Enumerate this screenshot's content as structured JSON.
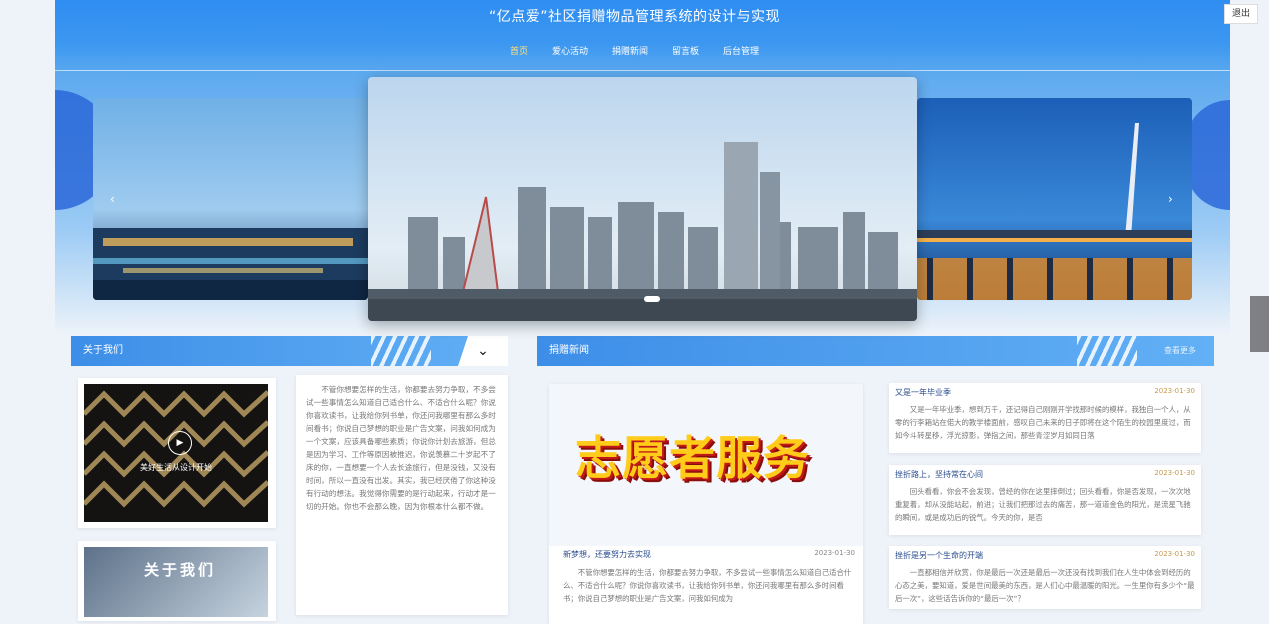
{
  "header": {
    "title": "“亿点爱”社区捐赠物品管理系统的设计与实现",
    "logout": "退出",
    "nav": [
      "首页",
      "爱心活动",
      "捐赠新闻",
      "留言板",
      "后台管理"
    ]
  },
  "carousel": {
    "active_index": 1
  },
  "about": {
    "header": "关于我们",
    "video_caption": "美好生活从设计开始",
    "second_title": "关于我们",
    "text": "不管你想要怎样的生活，你都要去努力争取，不多尝试一些事情怎么知道自己适合什么、不适合什么呢？你说你喜欢读书，让我给你列书单，你还问我哪里有那么多时间看书；你说自己梦想的职业是广告文案，问我如何成为一个文案，应该具备哪些素质；你说你计划去旅游，但总是因为学习、工作等原因被推迟，你说羡慕二十岁起不了床的你，一直想要一个人去长途旅行，但是没钱，又没有时间，所以一直没有出发。其实，我已经厌倦了你这种没有行动的想法。我觉得你需要的是行动起来，行动才是一切的开始。你也不会那么晚，因为你根本什么都不做。"
  },
  "news": {
    "header": "捐赠新闻",
    "more": "查看更多",
    "featured": {
      "banner_text": "志愿者服务",
      "title": "新梦想，还要努力去实现",
      "date": "2023-01-30",
      "summary": "不管你想要怎样的生活，你都要去努力争取，不多尝试一些事情怎么知道自己适合什么、不适合什么呢？你说你喜欢读书，让我给你列书单，你还问我哪里有那么多时间看书；你说自己梦想的职业是广告文案，问我如何成为"
    },
    "items": [
      {
        "title": "又是一年毕业季",
        "date": "2023-01-30",
        "summary": "又是一年毕业季，想到万千，还记得自己刚刚开学找那时候的模样，我独自一个人，从零的行李箱站在偌大的教学楼面前，感叹自己未来的日子即将在这个陌生的校园里度过，而如今斗转星移，浮光掠影，弹指之间，那些青涩岁月如同日落"
      },
      {
        "title": "挫折路上，坚持常在心间",
        "date": "2023-01-30",
        "summary": "回头看看，你会不会发现，曾经的你在这里摔倒过；回头看看，你是否发现，一次次地重复着，却从没能站起，前进；让我们把那过去的痛苦，那一道道金色的阳光，是流星飞驰的瞬间，或是成功后的锐气。今天的你，是否"
      },
      {
        "title": "挫折是另一个生命的开端",
        "date": "2023-01-30",
        "summary": "一直都相信并欣赏，你是最后一次还是最后一次还没有找到我们在人生中体会到经历的心态之美，要知道，爱是世间最美的东西，是人们心中最温暖的阳光。一生里你有多少个“最后一次”，这些话告诉你的“最后一次”？"
      }
    ]
  },
  "colors": {
    "primary": "#3d8ee8",
    "nav_active": "#ffe27a",
    "link": "#2a4d8f"
  }
}
